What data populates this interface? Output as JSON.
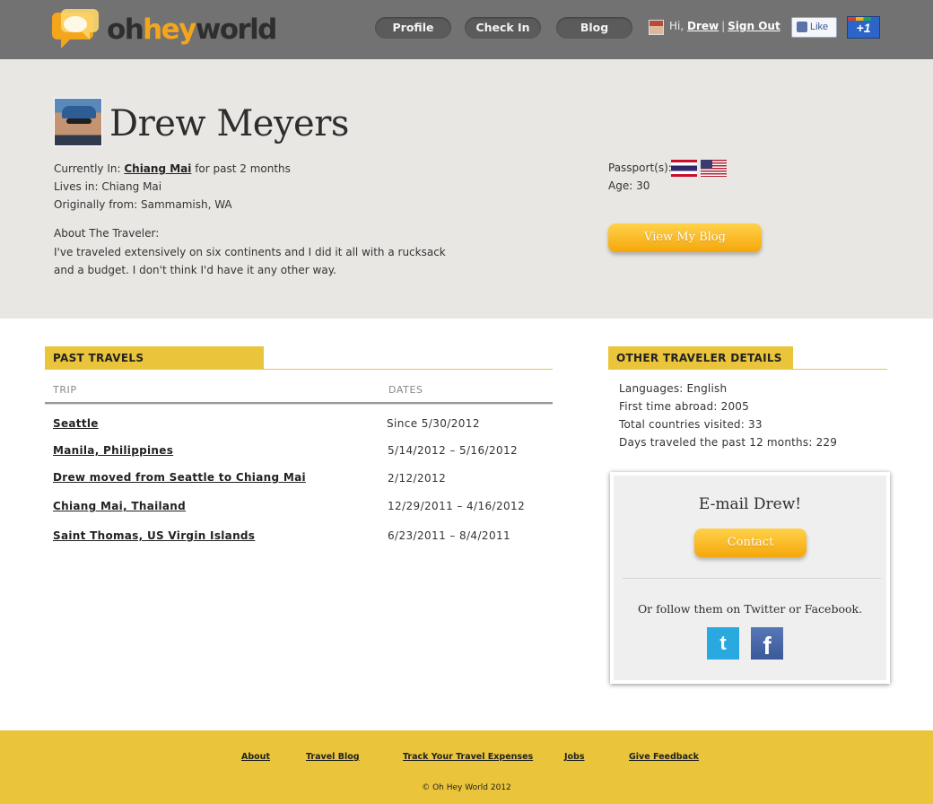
{
  "header": {
    "logo": {
      "oh": "oh",
      "hey": "hey",
      "world": "world"
    },
    "nav": {
      "profile": "Profile",
      "check_in": "Check In",
      "blog": "Blog"
    },
    "user": {
      "greeting": "Hi,",
      "name": "Drew",
      "separator": "|",
      "sign_out": "Sign Out"
    },
    "fb_like": "Like",
    "gplus": "+1"
  },
  "profile": {
    "name": "Drew Meyers",
    "currently_in_label": "Currently In:",
    "currently_in_city": "Chiang Mai",
    "currently_in_duration": "for past 2 months",
    "lives_in": "Lives in: Chiang Mai",
    "originally_from": "Originally from: Sammamish, WA",
    "about_label": "About The Traveler:",
    "about_text": "I've traveled extensively on six continents and I did it all with a rucksack and a budget. I don't think I'd have it any other way.",
    "passports_label": "Passport(s):",
    "passport_flags": [
      "flag-thailand-icon",
      "flag-usa-icon"
    ],
    "age": "Age: 30",
    "view_blog_button": "View My Blog"
  },
  "past_travels": {
    "title": "PAST TRAVELS",
    "col_trip": "TRIP",
    "col_dates": "DATES",
    "rows": [
      {
        "trip": "Seattle",
        "dates": "Since 5/30/2012"
      },
      {
        "trip": "Manila, Philippines",
        "dates": "5/14/2012 – 5/16/2012"
      },
      {
        "trip": "Drew moved from Seattle to Chiang Mai",
        "dates": "2/12/2012"
      },
      {
        "trip": "Chiang Mai, Thailand",
        "dates": "12/29/2011 – 4/16/2012"
      },
      {
        "trip": "Saint Thomas, US Virgin Islands",
        "dates": "6/23/2011 – 8/4/2011"
      }
    ]
  },
  "other_details": {
    "title": "OTHER TRAVELER DETAILS",
    "languages": "Languages: English",
    "first_abroad": "First time abroad: 2005",
    "countries": "Total countries visited: 33",
    "days": "Days traveled the past 12 months: 229"
  },
  "contact": {
    "title": "E-mail Drew!",
    "button": "Contact",
    "follow_text": "Or follow them on Twitter or Facebook.",
    "twitter_glyph": "t",
    "facebook_glyph": "f"
  },
  "footer": {
    "links": {
      "about": "About",
      "travel_blog": "Travel Blog",
      "expenses": "Track Your Travel Expenses",
      "jobs": "Jobs",
      "feedback": "Give Feedback"
    },
    "copyright": "© Oh Hey World 2012"
  },
  "colors": {
    "header_bg": "#727272",
    "accent_yellow": "#eac43a",
    "button_orange": "#f5a70a",
    "profile_bg": "#e8e7e4"
  }
}
